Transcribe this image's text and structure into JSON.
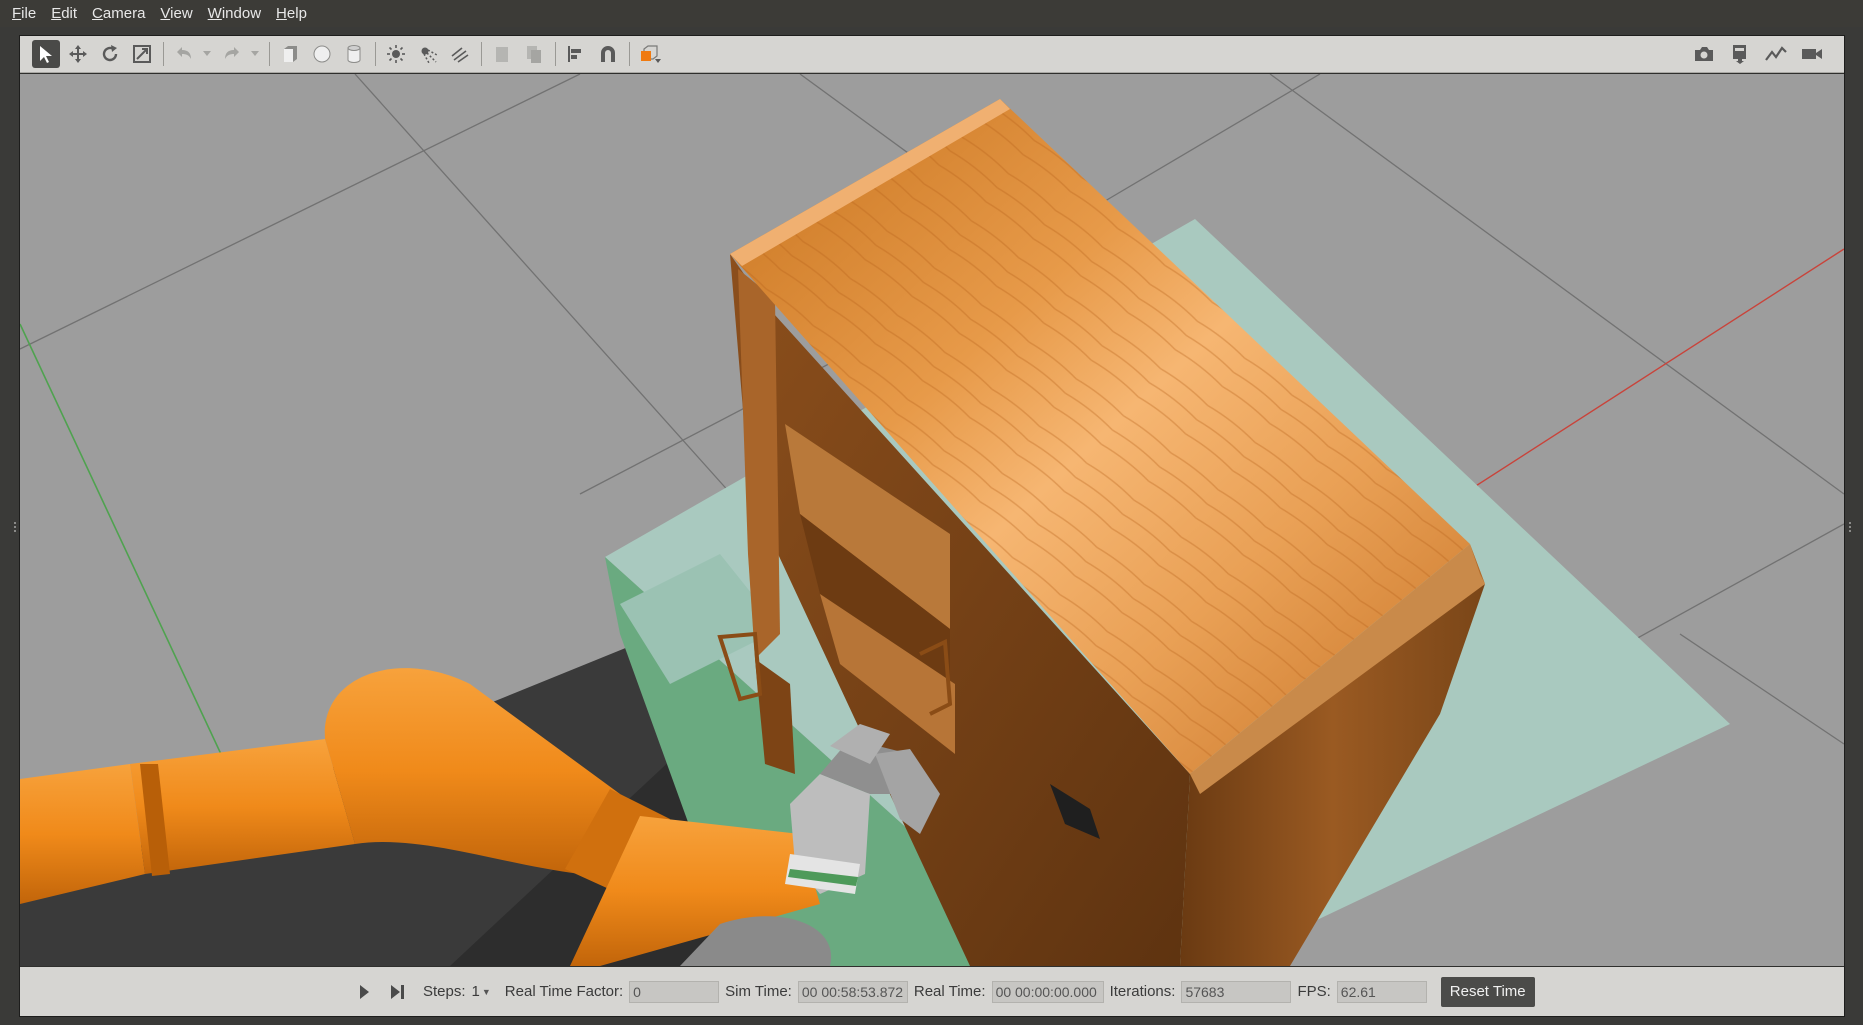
{
  "menu": {
    "items": [
      {
        "key": "F",
        "rest": "ile"
      },
      {
        "key": "E",
        "rest": "dit"
      },
      {
        "key": "C",
        "rest": "amera"
      },
      {
        "key": "V",
        "rest": "iew"
      },
      {
        "key": "W",
        "rest": "indow"
      },
      {
        "key": "H",
        "rest": "elp"
      }
    ]
  },
  "toolbar": {
    "left_icons": [
      "select-arrow-icon",
      "translate-icon",
      "rotate-icon",
      "scale-icon",
      "undo-icon",
      "redo-icon",
      "box-shape-icon",
      "sphere-shape-icon",
      "cylinder-shape-icon",
      "point-light-icon",
      "spot-light-icon",
      "directional-light-icon",
      "copy-icon",
      "paste-icon",
      "align-icon",
      "snap-magnet-icon",
      "view-angle-icon"
    ],
    "right_icons": [
      "screenshot-camera-icon",
      "log-icon",
      "plot-icon",
      "video-record-icon"
    ]
  },
  "status": {
    "steps_label": "Steps:",
    "steps_value": "1",
    "real_time_factor_label": "Real Time Factor:",
    "real_time_factor_value": "0",
    "sim_time_label": "Sim Time:",
    "sim_time_value": "00 00:58:53.872",
    "real_time_label": "Real Time:",
    "real_time_value": "00 00:00:00.000",
    "iterations_label": "Iterations:",
    "iterations_value": "57683",
    "fps_label": "FPS:",
    "fps_value": "62.61",
    "reset_label": "Reset Time"
  },
  "colors": {
    "ground": "#9d9d9d",
    "grid": "#6e6e6e",
    "wood": "#d78a3a",
    "robot_orange": "#f08a1a",
    "table_green": "#6aaa80",
    "table_top": "#a9c9bf",
    "gripper_gray": "#9a9a9a"
  }
}
